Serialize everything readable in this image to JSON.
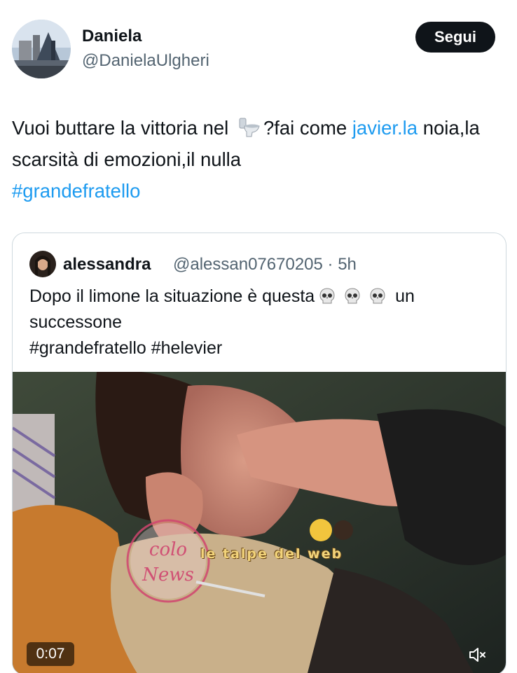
{
  "author": {
    "display_name": "Daniela",
    "handle": "@DanielaUlgheri",
    "follow_label": "Segui"
  },
  "tweet": {
    "text_1": "Vuoi buttare la vittoria nel",
    "text_2": "?fai come ",
    "link_1": "javier.la",
    "text_3": " noia,la scarsità di emozioni,il nulla",
    "hashtag": "#grandefratello"
  },
  "quoted": {
    "name": "alessandra",
    "handle_time": "@alessan07670205 · 5h",
    "text_line_1": "Dopo il limone la situazione è questa",
    "text_after_emoji": " un",
    "text_line_2": "successone",
    "text_line_3": "#grandefratello #helevier"
  },
  "video": {
    "duration": "0:07",
    "watermark": "le talpe del web"
  },
  "colors": {
    "text": "#0f1419",
    "secondary": "#536471",
    "link": "#1d9bf0",
    "button_bg": "#0f1419"
  },
  "icons": {
    "inline_emoji": "toilet-icon",
    "skull_emoji": "skull-icon",
    "volume": "mute-icon"
  }
}
